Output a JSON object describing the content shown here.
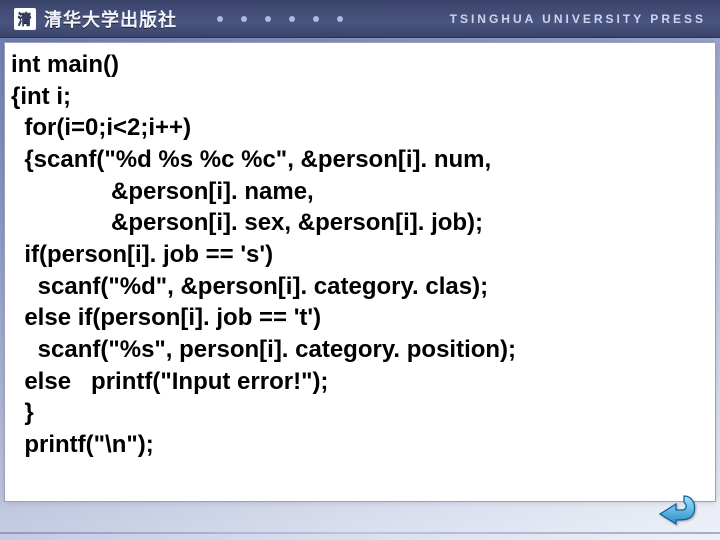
{
  "header": {
    "logo_text": "清华大学出版社",
    "press_en": "TSINGHUA UNIVERSITY PRESS"
  },
  "code": {
    "l01": "int main()",
    "l02": "{int i;",
    "l03": "  for(i=0;i<2;i++)",
    "l04": "  {scanf(\"%d %s %c %c\", &person[i]. num,",
    "l05": "               &person[i]. name,",
    "l06": "               &person[i]. sex, &person[i]. job);",
    "l07": "  if(person[i]. job == 's')",
    "l08": "    scanf(\"%d\", &person[i]. category. clas);",
    "l09": "  else if(person[i]. job == 't')",
    "l10": "    scanf(\"%s\", person[i]. category. position);",
    "l11": "  else   printf(\"Input error!\");",
    "l12": "  }",
    "l13": "  printf(\"\\n\");"
  },
  "nav": {
    "back_icon": "back-arrow"
  }
}
